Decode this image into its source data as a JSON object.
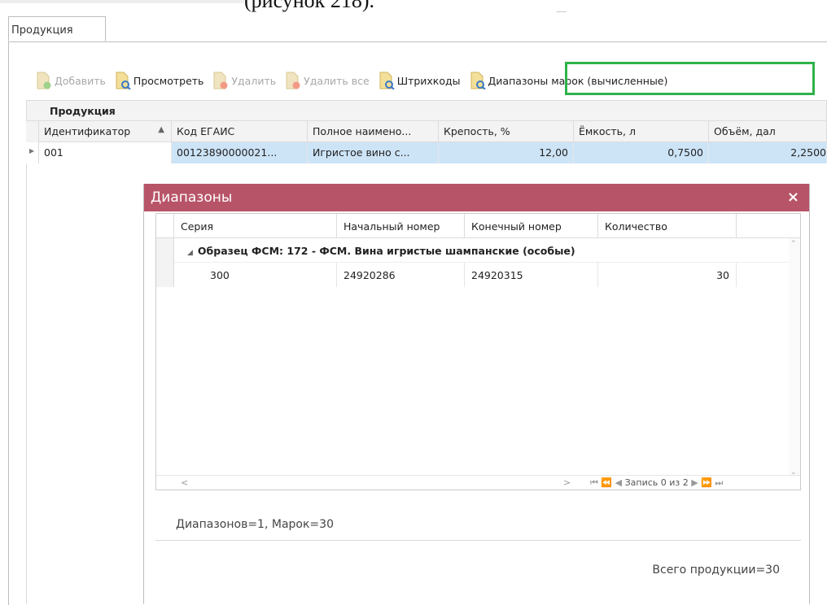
{
  "document": {
    "caption_fragment": "(рисунок 218)."
  },
  "tab": {
    "label": "Продукция"
  },
  "toolbar": {
    "add": "Добавить",
    "view": "Просмотреть",
    "delete": "Удалить",
    "delete_all": "Удалить все",
    "barcodes": "Штрихкоды",
    "ranges": "Диапазоны марок (вычисленные)"
  },
  "grid": {
    "band_label": "Продукция",
    "columns": [
      "Идентификатор",
      "Код ЕГАИС",
      "Полное наимено...",
      "Крепость, %",
      "Ёмкость, л",
      "Объём, дал"
    ],
    "sort_indicator": "▲",
    "row": {
      "id": "001",
      "egais": "00123890000021...",
      "name": "Игристое вино с...",
      "strength": "12,00",
      "capacity": "0,7500",
      "volume": "2,2500"
    }
  },
  "dialog": {
    "title": "Диапазоны",
    "close": "×",
    "columns": [
      "Серия",
      "Начальный номер",
      "Конечный номер",
      "Количество"
    ],
    "group_label": "Образец ФСМ: 172 - ФСМ. Вина игристые шампанские (особые)",
    "rows": [
      {
        "series": "300",
        "start": "24920286",
        "end": "24920315",
        "count": "30"
      }
    ],
    "pager": {
      "record": "Запись 0 из 2"
    },
    "summary": "Диапазонов=1, Марок=30",
    "total": "Всего продукции=30"
  },
  "colors": {
    "dialog_header": "#b85468",
    "highlight": "#2fb24a",
    "selected_row": "#cde4f7"
  }
}
